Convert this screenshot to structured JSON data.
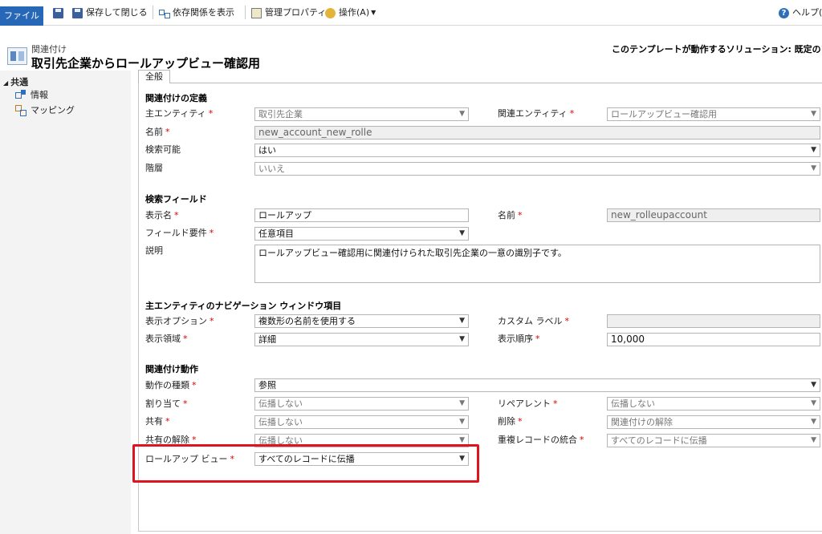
{
  "ribbon": {
    "file_label": "ファイル",
    "save_close_label": "保存して閉じる",
    "show_dependencies_label": "依存関係を表示",
    "managed_properties_label": "管理プロパティ",
    "actions_label": "操作(A)",
    "help_label": "ヘルプ(H"
  },
  "header": {
    "entity_label": "関連付け",
    "title": "取引先企業からロールアップビュー確認用",
    "solution_text": "このテンプレートが動作するソリューション: 既定のソリューション"
  },
  "nav": {
    "group_label": "共通",
    "items": [
      {
        "label": "情報"
      },
      {
        "label": "マッピング"
      }
    ]
  },
  "tab_label": "全般",
  "sections": {
    "definition": {
      "title": "関連付けの定義",
      "primary_entity": {
        "label": "主エンティティ",
        "value": "取引先企業"
      },
      "related_entity": {
        "label": "関連エンティティ",
        "value": "ロールアップビュー確認用"
      },
      "name": {
        "label": "名前",
        "value": "new_account_new_rolle"
      },
      "searchable": {
        "label": "検索可能",
        "value": "はい"
      },
      "hierarchical": {
        "label": "階層",
        "value": "いいえ"
      }
    },
    "lookup": {
      "title": "検索フィールド",
      "display_name": {
        "label": "表示名",
        "value": "ロールアップ"
      },
      "name": {
        "label": "名前",
        "value": "new_rolleupaccount"
      },
      "requirement": {
        "label": "フィールド要件",
        "value": "任意項目"
      },
      "description": {
        "label": "説明",
        "value": "ロールアップビュー確認用に関連付けられた取引先企業の一意の識別子です。"
      }
    },
    "navigation": {
      "title": "主エンティティのナビゲーション ウィンドウ項目",
      "display_option": {
        "label": "表示オプション",
        "value": "複数形の名前を使用する"
      },
      "custom_label": {
        "label": "カスタム ラベル",
        "value": ""
      },
      "display_area": {
        "label": "表示領域",
        "value": "詳細"
      },
      "display_order": {
        "label": "表示順序",
        "value": "10,000"
      }
    },
    "behavior": {
      "title": "関連付け動作",
      "type": {
        "label": "動作の種類",
        "value": "参照"
      },
      "assign": {
        "label": "割り当て",
        "value": "伝播しない"
      },
      "reparent": {
        "label": "リペアレント",
        "value": "伝播しない"
      },
      "share": {
        "label": "共有",
        "value": "伝播しない"
      },
      "delete": {
        "label": "削除",
        "value": "関連付けの解除"
      },
      "unshare": {
        "label": "共有の解除",
        "value": "伝播しない"
      },
      "merge": {
        "label": "重複レコードの統合",
        "value": "すべてのレコードに伝播"
      },
      "rollup_view": {
        "label": "ロールアップ ビュー",
        "value": "すべてのレコードに伝播"
      }
    }
  },
  "colors": {
    "file_button": "#2767b8",
    "required_mark": "#dd0000",
    "highlight": "#e0141e"
  }
}
